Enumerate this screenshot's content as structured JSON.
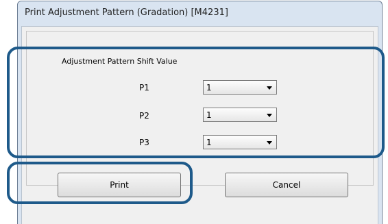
{
  "window": {
    "title": "Print Adjustment Pattern (Gradation) [M4231]"
  },
  "group": {
    "label": "Adjustment Pattern Shift Value"
  },
  "rows": [
    {
      "label": "P1",
      "value": "1"
    },
    {
      "label": "P2",
      "value": "1"
    },
    {
      "label": "P3",
      "value": "1"
    }
  ],
  "buttons": {
    "print": "Print",
    "cancel": "Cancel"
  },
  "colors": {
    "highlight": "#1e5a8a",
    "frame": "#d9e4f1",
    "client": "#f0f0f0"
  }
}
